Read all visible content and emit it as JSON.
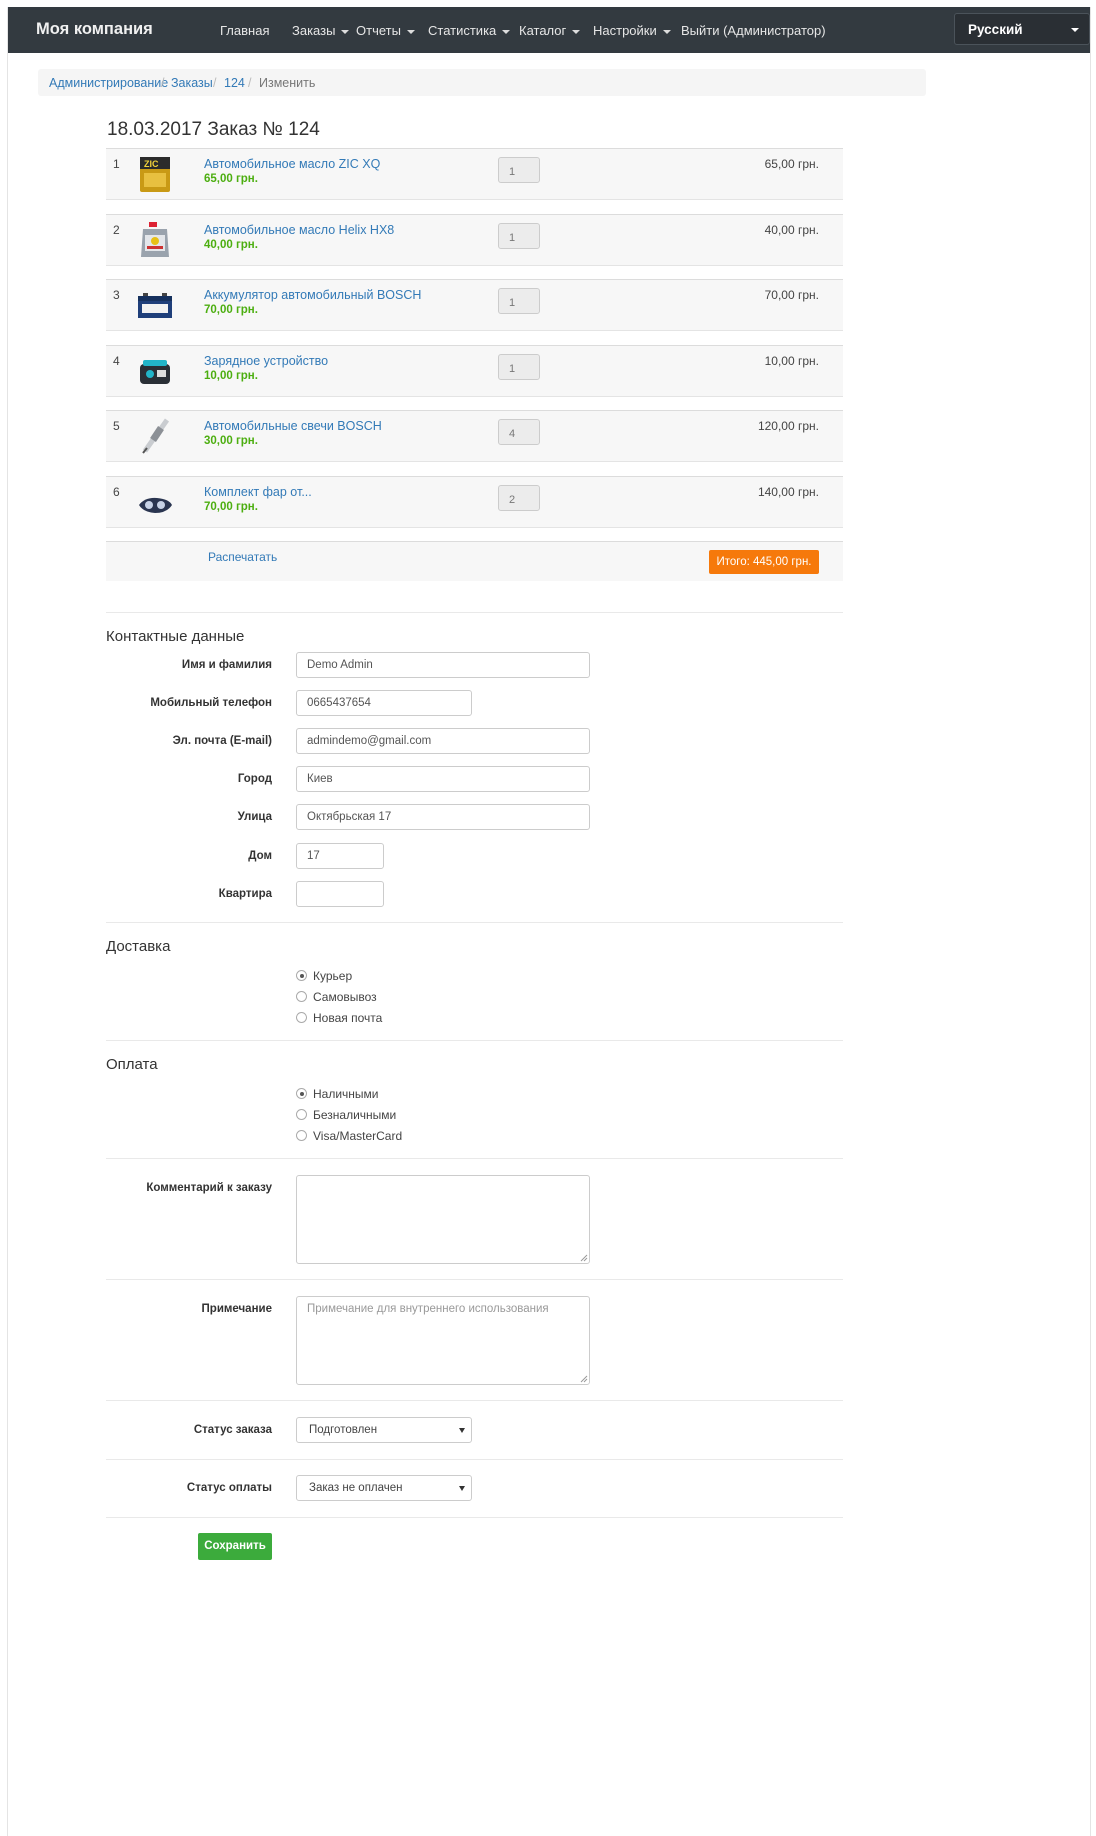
{
  "navbar": {
    "brand": "Моя компания",
    "items": [
      {
        "label": "Главная"
      },
      {
        "label": "Заказы"
      },
      {
        "label": "Отчеты"
      },
      {
        "label": "Статистика"
      },
      {
        "label": "Каталог"
      },
      {
        "label": "Настройки"
      },
      {
        "label": "Выйти (Администратор)"
      }
    ],
    "language": "Русский"
  },
  "breadcrumb": [
    "Администрирование",
    "Заказы",
    "124",
    "Изменить"
  ],
  "title": "18.03.2017 Заказ № 124",
  "order": {
    "items": [
      {
        "num": "1",
        "name": "Автомобильное масло ZIC XQ",
        "price": "65,00 грн.",
        "qty": "1",
        "sum": "65,00 грн.",
        "icon": "oil-can-icon"
      },
      {
        "num": "2",
        "name": "Автомобильное масло Helix HX8",
        "price": "40,00 грн.",
        "qty": "1",
        "sum": "40,00 грн.",
        "icon": "oil-canister-icon"
      },
      {
        "num": "3",
        "name": "Аккумулятор автомобильный BOSCH",
        "price": "70,00 грн.",
        "qty": "1",
        "sum": "70,00 грн.",
        "icon": "battery-icon"
      },
      {
        "num": "4",
        "name": "Зарядное устройство",
        "price": "10,00 грн.",
        "qty": "1",
        "sum": "10,00 грн.",
        "icon": "charger-icon"
      },
      {
        "num": "5",
        "name": "Автомобильные свечи BOSCH",
        "price": "30,00 грн.",
        "qty": "4",
        "sum": "120,00 грн.",
        "icon": "spark-plug-icon"
      },
      {
        "num": "6",
        "name": "Комплект фар от...",
        "price": "70,00 грн.",
        "qty": "2",
        "sum": "140,00 грн.",
        "icon": "headlight-icon"
      }
    ],
    "print": "Распечатать",
    "total": "Итого: 445,00 грн."
  },
  "contact": {
    "title": "Контактные данные",
    "name_label": "Имя и фамилия",
    "name": "Demo Admin",
    "phone_label": "Мобильный телефон",
    "phone": "0665437654",
    "email_label": "Эл. почта (E-mail)",
    "email": "admindemo@gmail.com",
    "city_label": "Город",
    "city": "Киев",
    "street_label": "Улица",
    "street": "Октябрьская 17",
    "house_label": "Дом",
    "house": "17",
    "apt_label": "Квартира",
    "apt": ""
  },
  "delivery": {
    "title": "Доставка",
    "options": [
      "Курьер",
      "Самовывоз",
      "Новая почта"
    ],
    "selected": "Курьер"
  },
  "payment": {
    "title": "Оплата",
    "options": [
      "Наличными",
      "Безналичными",
      "Visa/MasterCard"
    ],
    "selected": "Наличными"
  },
  "comment": {
    "label": "Комментарий к заказу",
    "value": ""
  },
  "note": {
    "label": "Примечание",
    "placeholder": "Примечание для внутреннего использования"
  },
  "order_status": {
    "label": "Статус заказа",
    "value": "Подготовлен"
  },
  "payment_status": {
    "label": "Статус оплаты",
    "value": "Заказ не оплачен"
  },
  "save": "Сохранить",
  "colors": {
    "navbar": "#333a40",
    "link": "#337ab7",
    "price": "#4cae10",
    "total": "#f6790b",
    "save": "#3cab3c"
  }
}
